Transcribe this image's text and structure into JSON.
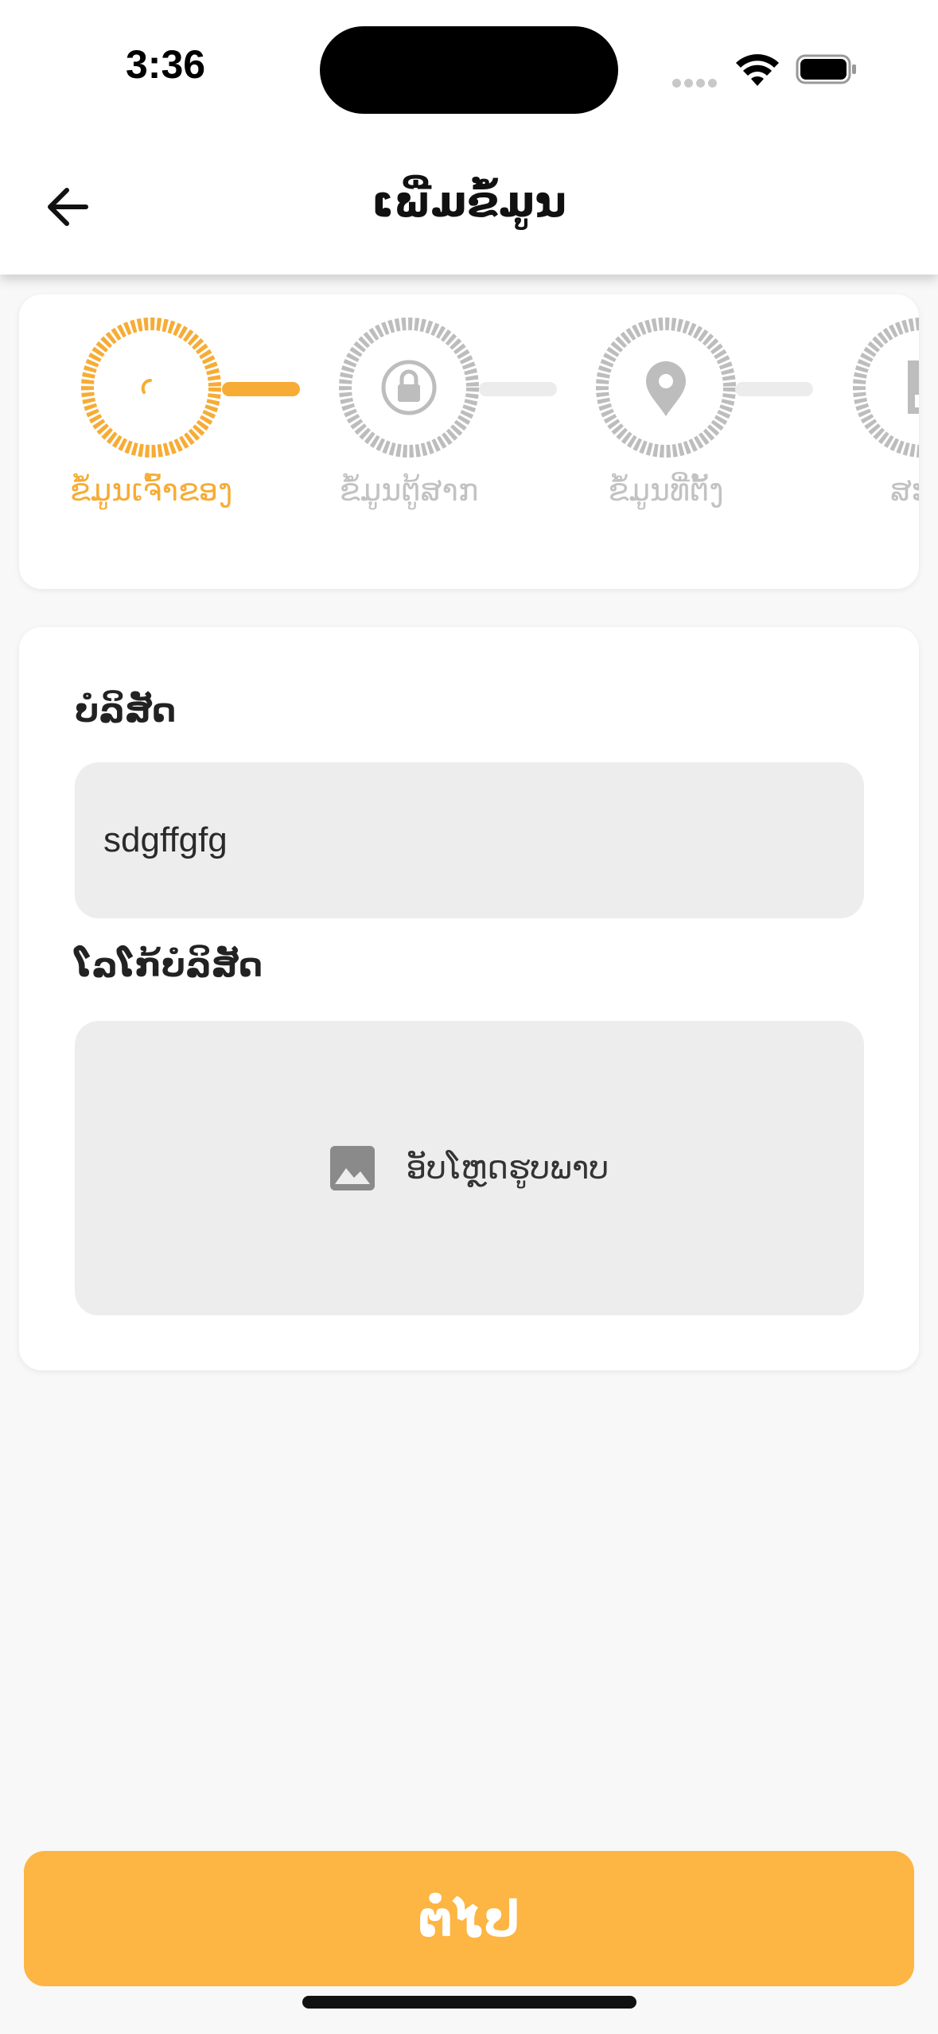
{
  "status_bar": {
    "time": "3:36",
    "signal_icon": "signal-dots-icon",
    "wifi_icon": "wifi-icon",
    "battery_icon": "battery-full-icon"
  },
  "header": {
    "title": "ເພີ່ມຂໍ້ມູນ",
    "back_icon": "arrow-left-icon"
  },
  "stepper": {
    "steps": [
      {
        "label": "ຂໍ້ມູນເຈົ້າຂອງ",
        "icon": "loading-spinner-icon",
        "state": "active"
      },
      {
        "label": "ຂໍ້ມູນຕູ້ສາກ",
        "icon": "lock-icon",
        "state": "pending"
      },
      {
        "label": "ຂໍ້ມູນທີ່ຕັ້ງ",
        "icon": "location-pin-icon",
        "state": "pending"
      },
      {
        "label": "ສະຫຼ",
        "icon": "report-chart-icon",
        "state": "pending"
      }
    ],
    "colors": {
      "active": "#f6ac35",
      "pending": "#bdbdbd",
      "connector_pending": "#ececec"
    }
  },
  "form": {
    "company_label": "ບໍລິສັດ",
    "company_value": "sdgffgfg",
    "logo_label": "ໂລໂກ້ບໍລິສັດ",
    "upload_text": "ອັບໂຫຼດຮູບພາບ",
    "upload_icon": "image-icon"
  },
  "footer": {
    "next_label": "ຕໍ່ໄປ",
    "accent_color": "#fdb543"
  }
}
